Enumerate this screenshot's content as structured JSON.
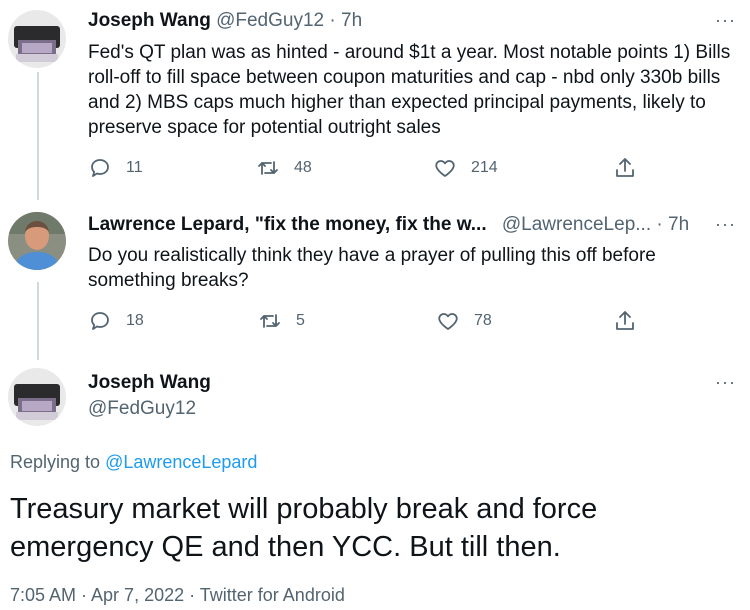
{
  "tweets": [
    {
      "name": "Joseph Wang",
      "handle": "@FedGuy12",
      "separator": "·",
      "time": "7h",
      "text": "Fed's QT plan was as hinted - around $1t a year. Most notable points 1) Bills roll-off to fill space between coupon maturities and cap - nbd only 330b bills and 2) MBS caps much higher than expected principal payments, likely to preserve space for potential outright sales",
      "replies": "11",
      "retweets": "48",
      "likes": "214",
      "more": "···"
    },
    {
      "name": "Lawrence Lepard, \"fix the money, fix the w...",
      "handle": "@LawrenceLep...",
      "separator": "·",
      "time": "7h",
      "text": "Do you realistically think they have a prayer of pulling this off before something breaks?",
      "replies": "18",
      "retweets": "5",
      "likes": "78",
      "more": "···"
    }
  ],
  "focused": {
    "name": "Joseph Wang",
    "handle": "@FedGuy12",
    "more": "···",
    "replying_prefix": "Replying to ",
    "replying_to": "@LawrenceLepard",
    "text": "Treasury market will probably break and force emergency QE and then YCC. But till then.",
    "meta": "7:05 AM · Apr 7, 2022 · Twitter for Android"
  },
  "icons": {
    "reply": "reply-icon",
    "retweet": "retweet-icon",
    "like": "heart-icon",
    "share": "share-icon",
    "more": "more-icon"
  },
  "colors": {
    "text": "#0f1419",
    "secondary": "#536471",
    "link": "#1d9bf0",
    "thread_line": "#cfd9de"
  }
}
